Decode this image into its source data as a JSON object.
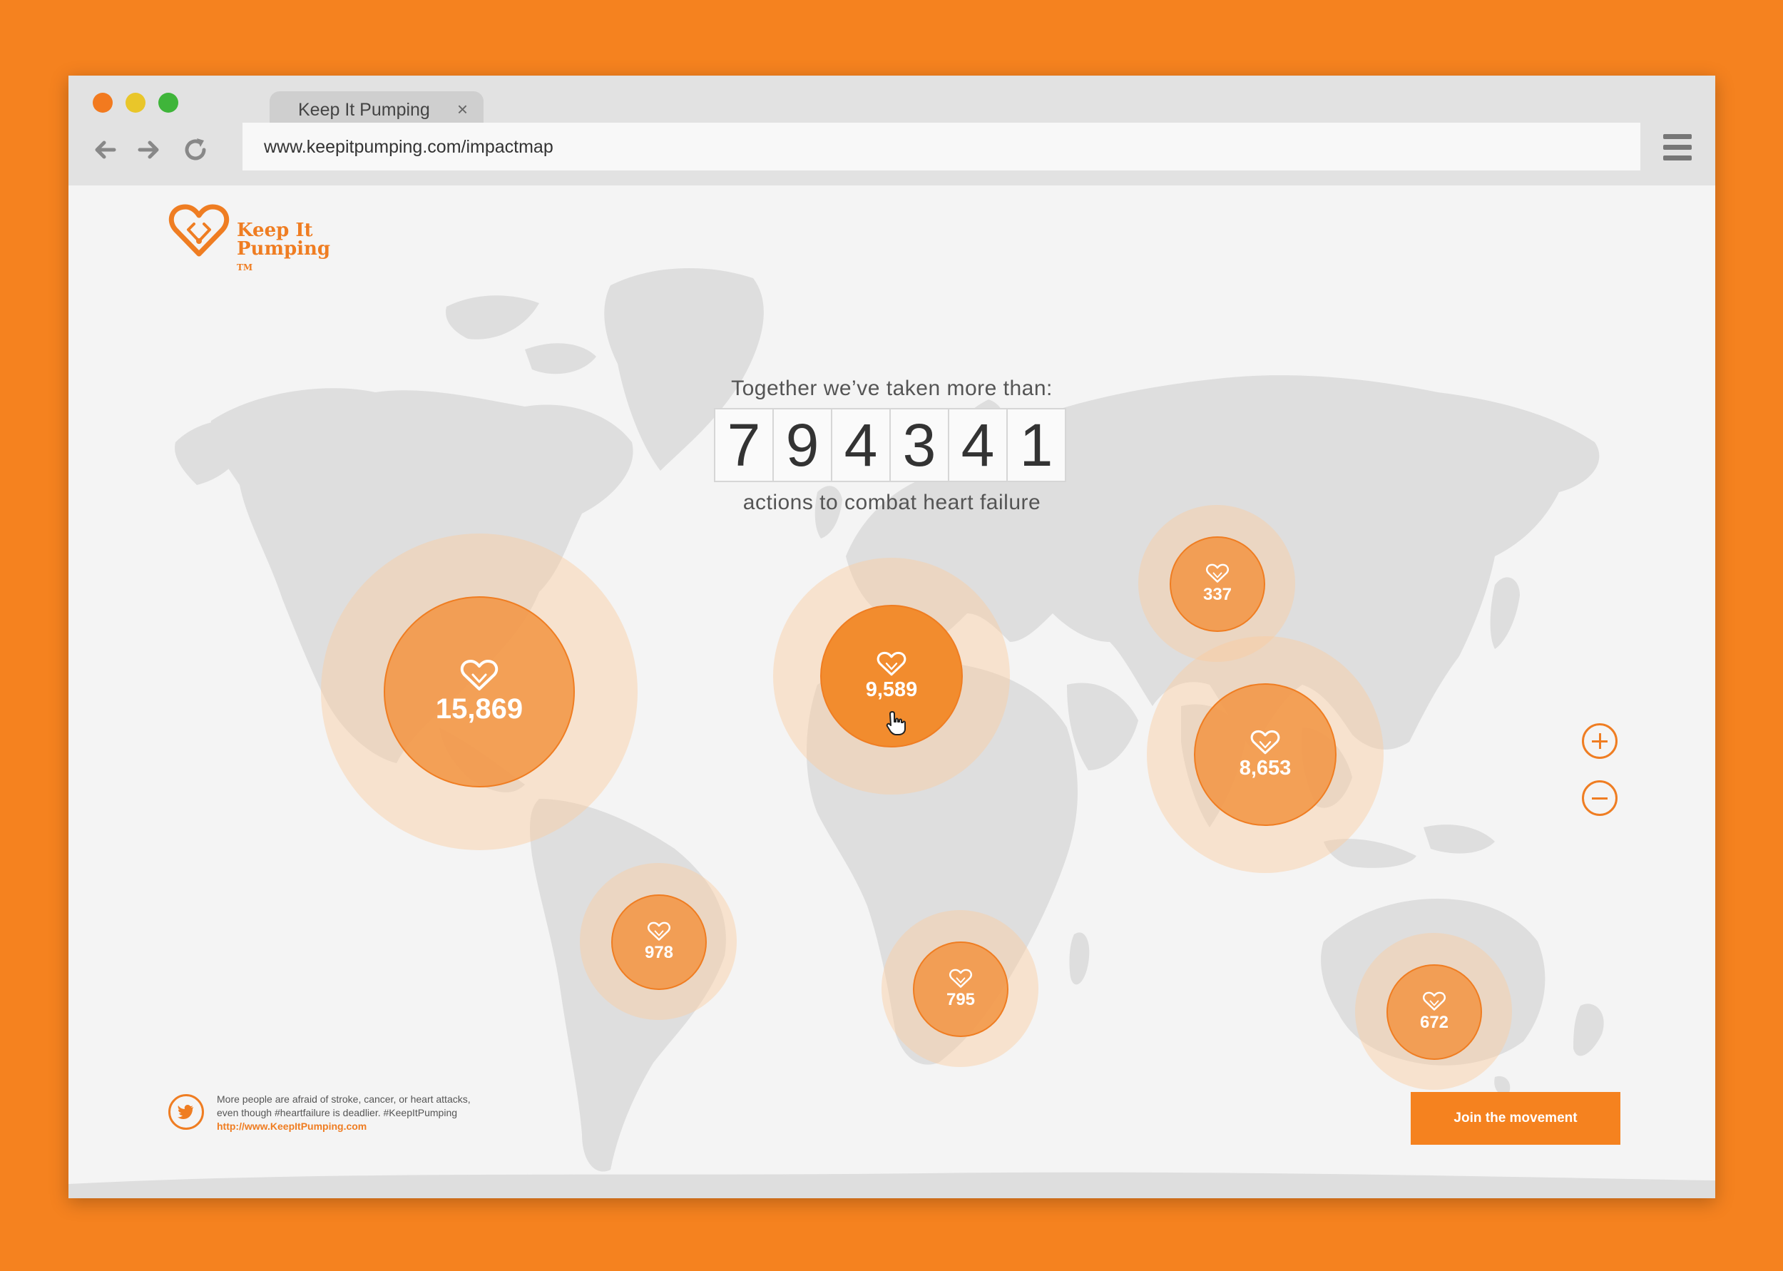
{
  "browser": {
    "tab_title": "Keep It Pumping",
    "tab_close": "×",
    "url": "www.keepitpumping.com/impactmap"
  },
  "brand": {
    "name_line1": "Keep It",
    "name_line2": "Pumping",
    "tm": "TM",
    "accent": "#f5821f"
  },
  "counter": {
    "headline": "Together we’ve taken more than:",
    "digits": [
      "7",
      "9",
      "4",
      "3",
      "4",
      "1"
    ],
    "caption": "actions to combat heart failure"
  },
  "regions": [
    {
      "value": "15,869"
    },
    {
      "value": "9,589"
    },
    {
      "value": "337"
    },
    {
      "value": "8,653"
    },
    {
      "value": "978"
    },
    {
      "value": "795"
    },
    {
      "value": "672"
    }
  ],
  "zoom": {
    "in_icon": "plus-icon",
    "out_icon": "minus-icon"
  },
  "tweet": {
    "line1": "More people are afraid of stroke, cancer, or heart attacks,",
    "line2": "even though #heartfailure is deadlier. #KeepItPumping",
    "link": "http://www.KeepItPumping.com"
  },
  "cta": {
    "label": "Join the movement"
  }
}
